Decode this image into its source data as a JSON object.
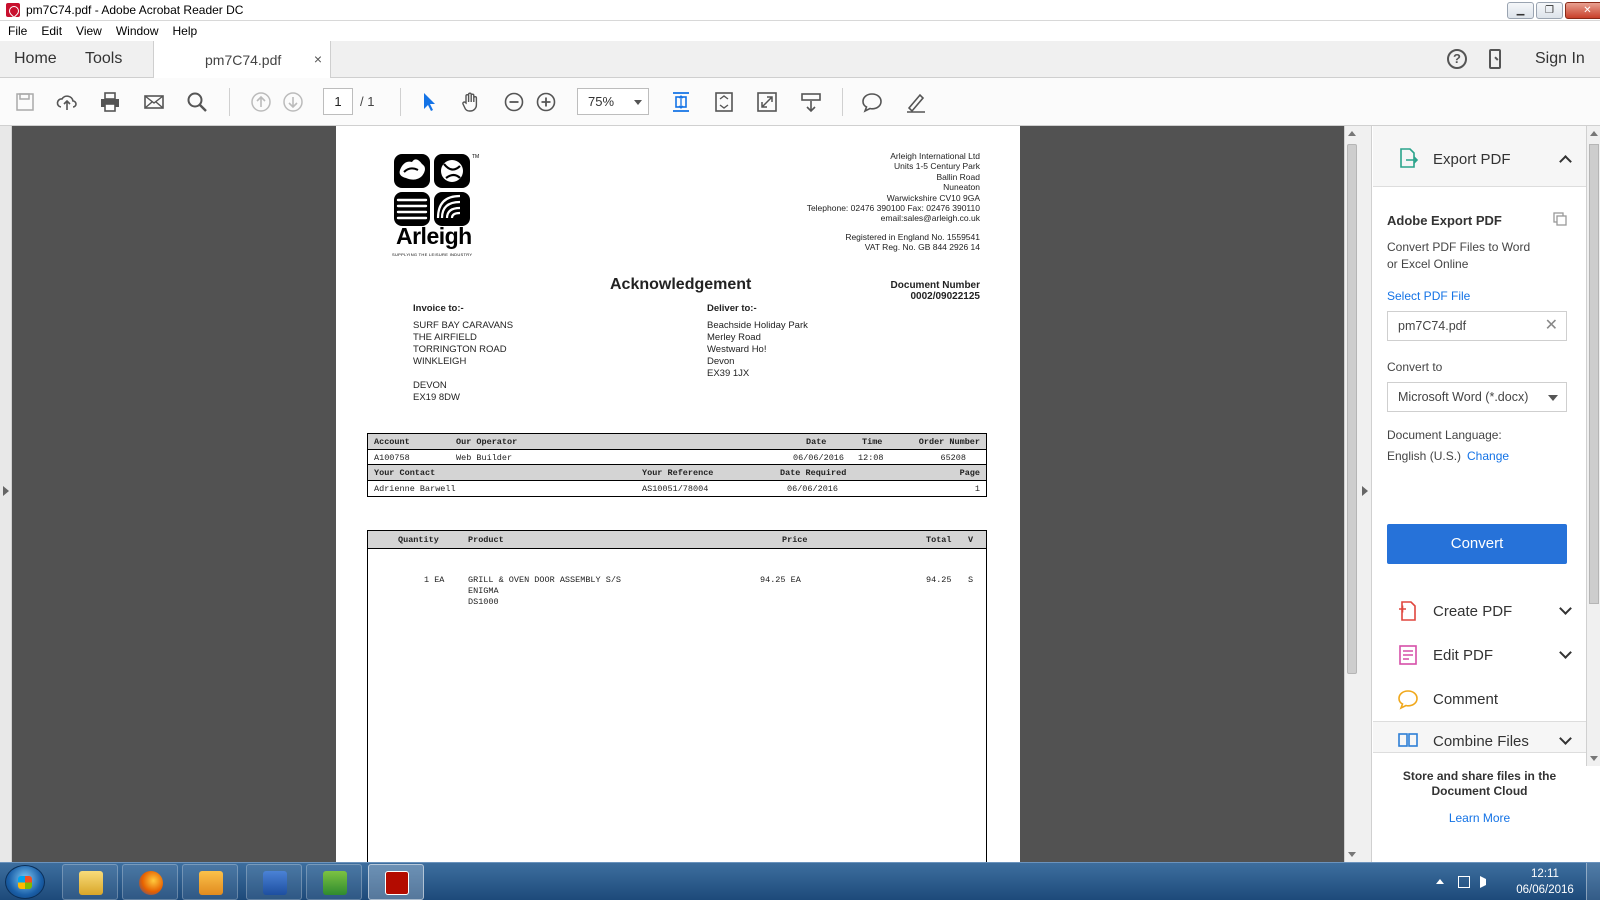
{
  "window": {
    "title": "pm7C74.pdf - Adobe Acrobat Reader DC"
  },
  "menu": [
    "File",
    "Edit",
    "View",
    "Window",
    "Help"
  ],
  "tabs": {
    "home": "Home",
    "tools": "Tools",
    "document": "pm7C74.pdf",
    "close": "×",
    "sign_in": "Sign In",
    "help": "?"
  },
  "toolbar": {
    "page_current": "1",
    "page_total": "/ 1",
    "zoom": "75%"
  },
  "document": {
    "company_logo_text": "Arleigh",
    "company_logo_tagline": "SUPPLYING THE LEISURE INDUSTRY",
    "company_address": [
      "Arleigh International Ltd",
      "Units 1-5 Century Park",
      "Ballin Road",
      "Nuneaton",
      "Warwickshire CV10 9GA",
      "Telephone: 02476 390100  Fax: 02476 390110",
      "email:sales@arleigh.co.uk"
    ],
    "registration": [
      "Registered in England No. 1559541",
      "VAT Reg. No. GB 844 2926 14"
    ],
    "title": "Acknowledgement",
    "document_number_label": "Document Number",
    "document_number": "0002/09022125",
    "invoice_to": {
      "label": "Invoice to:-",
      "lines": [
        "SURF BAY CARAVANS",
        "THE AIRFIELD",
        "TORRINGTON ROAD",
        "WINKLEIGH",
        "",
        "DEVON",
        "EX19 8DW"
      ]
    },
    "deliver_to": {
      "label": "Deliver to:-",
      "lines": [
        "Beachside Holiday Park",
        "Merley Road",
        "Westward Ho!",
        "Devon",
        "EX39 1JX"
      ]
    },
    "header_table": {
      "h1": {
        "account": "Account",
        "operator": "Our Operator",
        "date": "Date",
        "time": "Time",
        "order": "Order Number"
      },
      "r1": {
        "account": "A100758",
        "operator": "Web Builder",
        "date": "06/06/2016",
        "time": "12:08",
        "order": "65208"
      },
      "h2": {
        "contact": "Your Contact",
        "reference": "Your Reference",
        "required": "Date Required",
        "page": "Page"
      },
      "r2": {
        "contact": "Adrienne Barwell",
        "reference": "AS10051/78004",
        "required": "06/06/2016",
        "page": "1"
      }
    },
    "items_table": {
      "columns": {
        "qty": "Quantity",
        "product": "Product",
        "price": "Price",
        "total": "Total",
        "vat": "V"
      },
      "rows": [
        {
          "qty": "1 EA",
          "product": "GRILL & OVEN DOOR ASSEMBLY S/S",
          "product2": "ENIGMA",
          "product3": "DS1000",
          "price": "94.25 EA",
          "total": "94.25",
          "vat": "S"
        }
      ]
    }
  },
  "right_panel": {
    "export_pdf": "Export PDF",
    "adobe_export_title": "Adobe Export PDF",
    "adobe_export_desc1": "Convert PDF Files to Word",
    "adobe_export_desc2": "or Excel Online",
    "select_file_label": "Select PDF File",
    "selected_file": "pm7C74.pdf",
    "convert_to_label": "Convert to",
    "convert_to_value": "Microsoft Word (*.docx)",
    "doc_language_label": "Document Language:",
    "doc_language_value": "English (U.S.)",
    "change_link": "Change",
    "convert_button": "Convert",
    "tools": [
      "Create PDF",
      "Edit PDF",
      "Comment",
      "Combine Files"
    ],
    "cloud_title": "Store and share files in the Document Cloud",
    "learn_more": "Learn More"
  },
  "taskbar": {
    "time": "12:11",
    "date": "06/06/2016"
  },
  "colors": {
    "accent": "#2672d9",
    "viewer_bg": "#525252",
    "taskbar": "#1d4a7a"
  }
}
